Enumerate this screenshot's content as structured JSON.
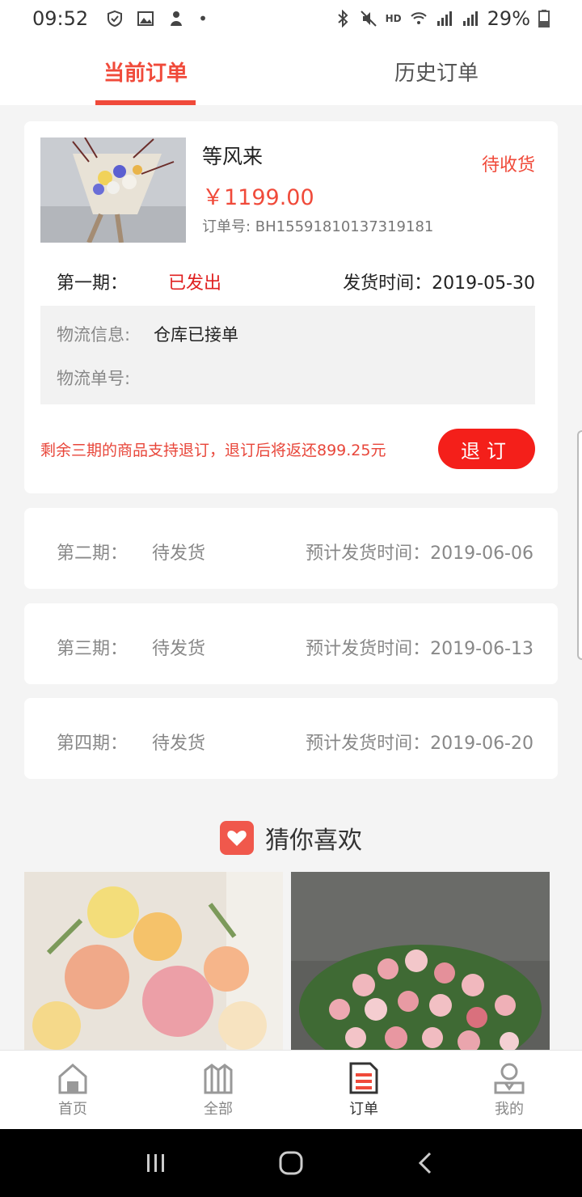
{
  "status_bar": {
    "time": "09:52",
    "battery": "29%",
    "network": "HD"
  },
  "tabs": {
    "current": "当前订单",
    "history": "历史订单"
  },
  "order": {
    "product_name": "等风来",
    "price": "￥1199.00",
    "order_no": "订单号: BH15591810137319181",
    "status": "待收货",
    "period1": {
      "label": "第一期：",
      "state": "已发出",
      "ship_time": "发货时间：2019-05-30"
    },
    "logistics": {
      "info_label": "物流信息:",
      "info_value": "仓库已接单",
      "no_label": "物流单号:"
    },
    "refund_text": "剩余三期的商品支持退订，退订后将返还899.25元",
    "refund_button": "退订"
  },
  "pending": [
    {
      "label": "第二期：",
      "state": "待发货",
      "date": "预计发货时间：2019-06-06"
    },
    {
      "label": "第三期：",
      "state": "待发货",
      "date": "预计发货时间：2019-06-13"
    },
    {
      "label": "第四期：",
      "state": "待发货",
      "date": "预计发货时间：2019-06-20"
    }
  ],
  "guess": {
    "title": "猜你喜欢"
  },
  "bottom_nav": [
    {
      "label": "首页"
    },
    {
      "label": "全部"
    },
    {
      "label": "订单"
    },
    {
      "label": "我的"
    }
  ],
  "colors": {
    "accent": "#f04a3a",
    "button": "#f41f1a"
  }
}
